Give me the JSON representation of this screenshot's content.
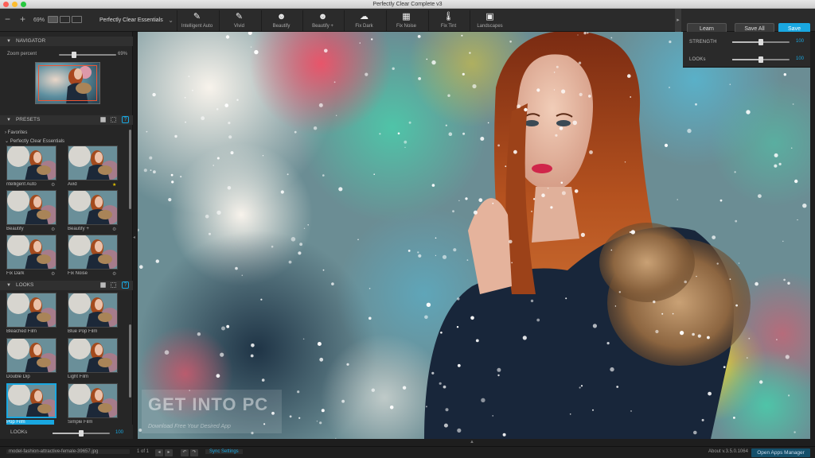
{
  "window": {
    "title": "Perfectly Clear Complete v3"
  },
  "toolbar": {
    "zoom": "69%",
    "zoom_out_icon": "minus-icon",
    "zoom_in_icon": "plus-icon",
    "preset_select": "Perfectly Clear Essentials",
    "tools": [
      {
        "label": "Intelligent Auto",
        "icon": "wand-hd-icon",
        "glyph": "✎"
      },
      {
        "label": "Vivid",
        "icon": "brush-icon",
        "glyph": "✎"
      },
      {
        "label": "Beautify",
        "icon": "face-icon",
        "glyph": "☻"
      },
      {
        "label": "Beautify +",
        "icon": "face-plus-icon",
        "glyph": "☻"
      },
      {
        "label": "Fix Dark",
        "icon": "cloud-icon",
        "glyph": "☁"
      },
      {
        "label": "Fix Noise",
        "icon": "noise-icon",
        "glyph": "▦"
      },
      {
        "label": "Fix Tint",
        "icon": "thermometer-icon",
        "glyph": "🌡"
      },
      {
        "label": "Landscapes",
        "icon": "landscape-icon",
        "glyph": "▣"
      }
    ],
    "learn": "Learn",
    "save_all": "Save All",
    "save": "Save"
  },
  "adjust": {
    "strength": {
      "label": "STRENGTH",
      "value": "100",
      "level": 1.0
    },
    "looks": {
      "label": "LOOKs",
      "value": "100",
      "level": 1.0
    }
  },
  "navigator": {
    "title": "NAVIGATOR",
    "zoom_label": "Zoom percent",
    "zoom_value": "69%"
  },
  "presets": {
    "title": "PRESETS",
    "favorites": "Favorites",
    "group": "Perfectly Clear Essentials",
    "items": [
      {
        "label": "ntelligent Auto",
        "mark": "⚙",
        "star": false
      },
      {
        "label": "Avid",
        "mark": "",
        "star": true
      },
      {
        "label": "Beautify",
        "mark": "⚙",
        "star": false
      },
      {
        "label": "Beautify +",
        "mark": "⚙",
        "star": false
      },
      {
        "label": "Fix Dark",
        "mark": "⚙",
        "star": false
      },
      {
        "label": "Fix Noise",
        "mark": "⚙",
        "star": false
      }
    ]
  },
  "looks": {
    "title": "LOOKS",
    "items": [
      {
        "label": "Bleached Film"
      },
      {
        "label": "Blue Pop Film"
      },
      {
        "label": "Double Dip"
      },
      {
        "label": "Light Film"
      },
      {
        "label": "Pop Film",
        "selected": true
      },
      {
        "label": "Simple Film"
      }
    ],
    "footer_label": "LOOKs",
    "footer_value": "100"
  },
  "watermark": {
    "line1": "GET INTO PC",
    "line2": "Download Free Your Desired App"
  },
  "status": {
    "filename": "model-fashion-attractive-female-39657.jpg",
    "page": "1 of 1",
    "sync": "Sync Settings",
    "about": "About v.3.5.0.1064",
    "open_apps": "Open Apps Manager"
  },
  "colors": {
    "accent": "#19a7e0"
  }
}
